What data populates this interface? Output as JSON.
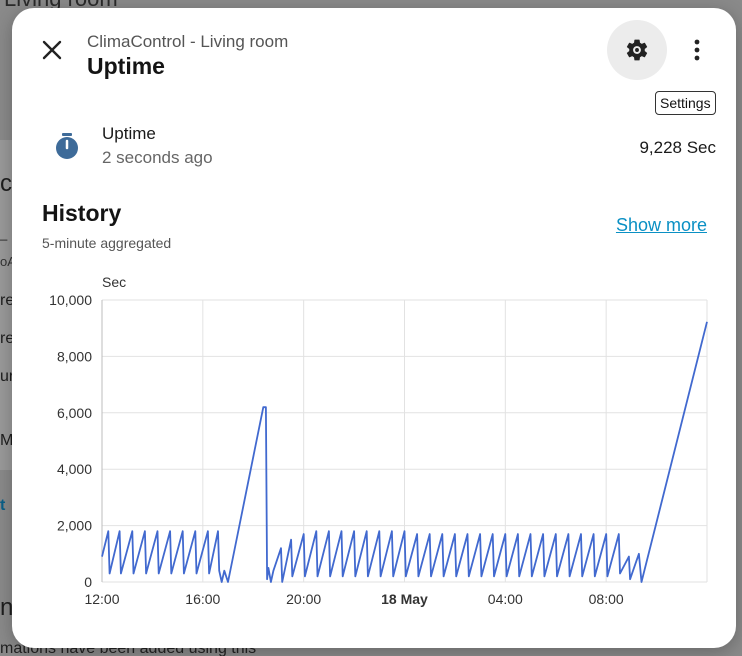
{
  "background": {
    "title": "Living room",
    "fragments": [
      "c",
      "_",
      "oA",
      "re",
      "re",
      "ur",
      "M",
      "t",
      "n"
    ],
    "bottom_text": "mations have been added using this"
  },
  "dialog": {
    "subtitle": "ClimaControl - Living room",
    "title": "Uptime",
    "settings_tooltip": "Settings"
  },
  "entity": {
    "icon": "timer-icon",
    "name": "Uptime",
    "last_changed": "2 seconds ago",
    "value": "9,228 Sec"
  },
  "history": {
    "title": "History",
    "subtitle": "5-minute aggregated",
    "show_more": "Show more"
  },
  "colors": {
    "line": "#4169cf",
    "link": "#0a90c4",
    "grid": "#e2e2e2"
  },
  "chart_data": {
    "type": "line",
    "ylabel": "Sec",
    "ylim": [
      0,
      10000
    ],
    "y_ticks": [
      "0",
      "2,000",
      "4,000",
      "6,000",
      "8,000",
      "10,000"
    ],
    "x_ticks": [
      "12:00",
      "16:00",
      "20:00",
      "18 May",
      "04:00",
      "08:00"
    ],
    "x_tick_hours": [
      0,
      4,
      8,
      12,
      16,
      20
    ],
    "bold_tick": "18 May",
    "x_range_hours": [
      0,
      24
    ],
    "series": [
      {
        "x_hours": [
          0,
          0.25,
          0.3,
          0.7,
          0.75,
          1.2,
          1.25,
          1.7,
          1.75,
          2.2,
          2.25,
          2.7,
          2.75,
          3.2,
          3.25,
          3.7,
          3.75,
          4.2,
          4.25,
          4.6,
          4.65,
          4.75,
          4.85,
          5.0,
          6.4,
          6.5,
          6.55,
          6.6,
          6.7,
          6.8,
          7.1,
          7.15,
          7.5,
          7.55,
          8.0,
          8.05,
          8.5,
          8.55,
          9.0,
          9.05,
          9.5,
          9.55,
          10.0,
          10.05,
          10.5,
          10.55,
          11.0,
          11.05,
          11.5,
          11.55,
          12.0,
          12.05,
          12.5,
          12.55,
          13.0,
          13.05,
          13.5,
          13.55,
          14.0,
          14.05,
          14.5,
          14.55,
          15.0,
          15.05,
          15.5,
          15.55,
          16.0,
          16.05,
          16.5,
          16.55,
          17.0,
          17.05,
          17.5,
          17.55,
          18.0,
          18.05,
          18.5,
          18.55,
          19.0,
          19.05,
          19.5,
          19.55,
          20.0,
          20.05,
          20.5,
          20.55,
          20.9,
          20.95,
          21.3,
          21.4,
          24.0
        ],
        "values": [
          900,
          1800,
          300,
          1800,
          300,
          1800,
          300,
          1800,
          300,
          1800,
          300,
          1800,
          300,
          1800,
          300,
          1800,
          300,
          1800,
          300,
          1800,
          400,
          0,
          400,
          0,
          6200,
          6200,
          100,
          500,
          0,
          400,
          1200,
          0,
          1500,
          200,
          1700,
          200,
          1800,
          200,
          1800,
          200,
          1800,
          200,
          1800,
          200,
          1800,
          200,
          1800,
          200,
          1800,
          200,
          1800,
          200,
          1700,
          200,
          1700,
          200,
          1700,
          200,
          1700,
          200,
          1700,
          200,
          1700,
          200,
          1700,
          200,
          1700,
          200,
          1700,
          200,
          1700,
          200,
          1700,
          200,
          1700,
          200,
          1700,
          200,
          1700,
          200,
          1700,
          200,
          1700,
          200,
          1700,
          300,
          900,
          100,
          1000,
          0,
          9228
        ]
      }
    ]
  }
}
